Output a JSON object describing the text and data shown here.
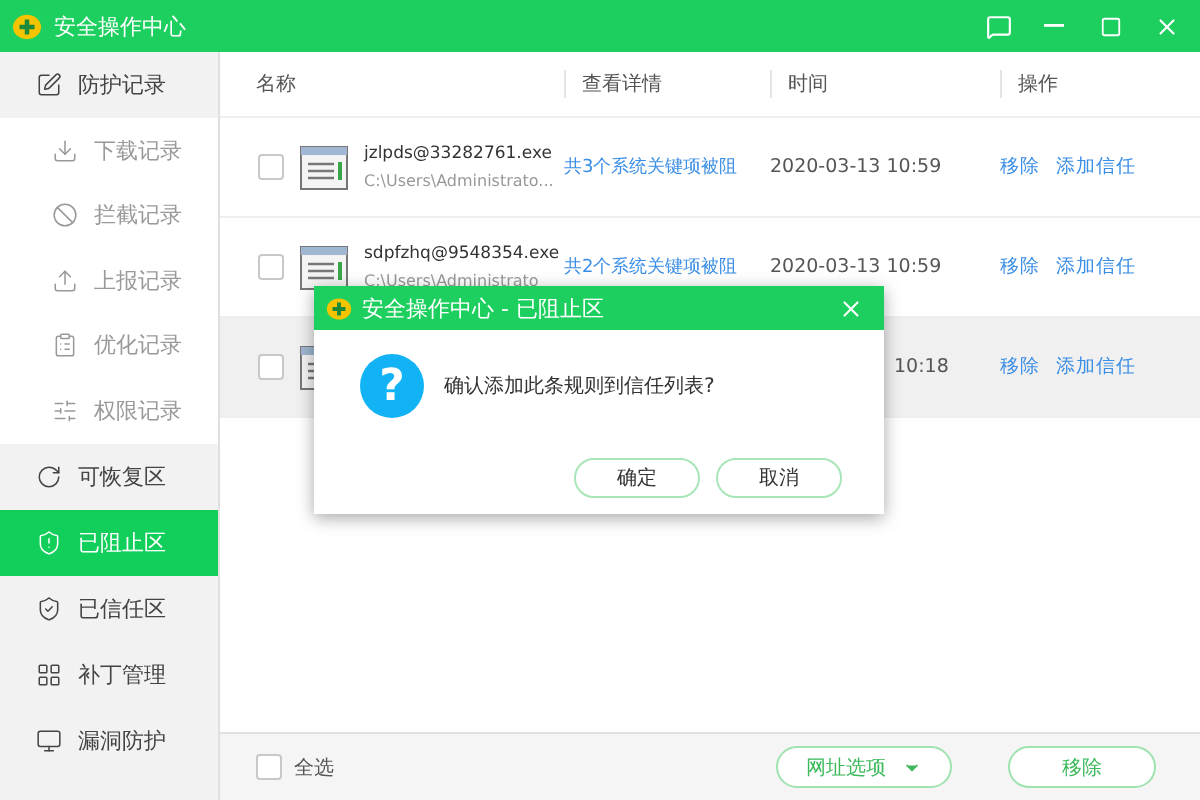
{
  "window": {
    "title": "安全操作中心"
  },
  "sidebar": {
    "items": [
      {
        "label": "防护记录",
        "selected": false,
        "children": [
          {
            "label": "下载记录",
            "selected": false
          },
          {
            "label": "拦截记录",
            "selected": false
          },
          {
            "label": "上报记录",
            "selected": false
          },
          {
            "label": "优化记录",
            "selected": false
          },
          {
            "label": "权限记录",
            "selected": false
          }
        ]
      },
      {
        "label": "可恢复区",
        "selected": false
      },
      {
        "label": "已阻止区",
        "selected": true
      },
      {
        "label": "已信任区",
        "selected": false
      },
      {
        "label": "补丁管理",
        "selected": false
      },
      {
        "label": "漏洞防护",
        "selected": false
      }
    ]
  },
  "table": {
    "columns": [
      "名称",
      "查看详情",
      "时间",
      "操作"
    ],
    "rows": [
      {
        "checked": false,
        "name": "jzlpds@33282761.exe",
        "path": "C:\\Users\\Administrato...",
        "detail": "共3个系统关键项被阻",
        "time": "2020-03-13 10:59",
        "actions": [
          "移除",
          "添加信任"
        ],
        "hovered": false
      },
      {
        "checked": false,
        "name": "sdpfzhq@9548354.exe",
        "path": "C:\\Users\\Administrato",
        "detail": "共2个系统关键项被阻",
        "time": "2020-03-13 10:59",
        "actions": [
          "移除",
          "添加信任"
        ],
        "hovered": false
      },
      {
        "checked": false,
        "time": "10:18",
        "actions": [
          "移除",
          "添加信任"
        ],
        "hovered": true
      }
    ]
  },
  "footer": {
    "select_all": {
      "label": "全选",
      "checked": false
    },
    "buttons": [
      {
        "label": "网址选项",
        "kind": "dropdown"
      },
      {
        "label": "移除",
        "kind": "plain"
      }
    ]
  },
  "dialog": {
    "icon_text": "?",
    "title": "安全操作中心 - 已阻止区",
    "message": "确认添加此条规则到信任列表?",
    "buttons": [
      "确定",
      "取消"
    ]
  }
}
